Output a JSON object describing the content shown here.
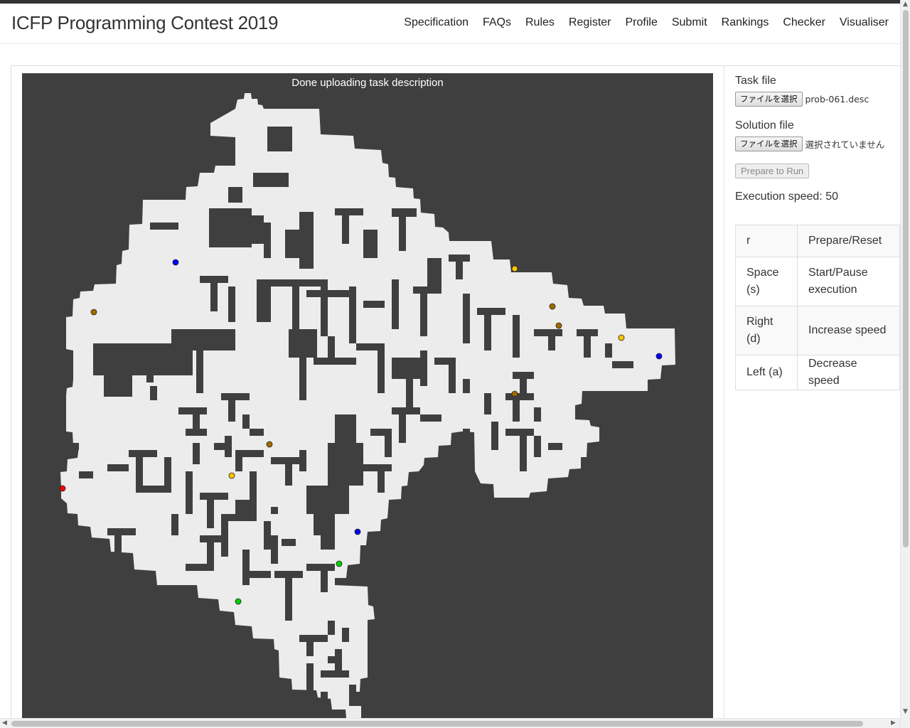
{
  "site_title": "ICFP Programming Contest 2019",
  "nav": [
    "Specification",
    "FAQs",
    "Rules",
    "Register",
    "Profile",
    "Submit",
    "Rankings",
    "Checker",
    "Visualiser"
  ],
  "canvas": {
    "status_text": "Done uploading task description",
    "background_color": "#3f3f3f",
    "map_color": "#ececec",
    "boosters": [
      {
        "type": "start",
        "color": "#ff0000"
      },
      {
        "type": "B",
        "color": "#ffc400"
      },
      {
        "type": "F",
        "color": "#a06a00"
      },
      {
        "type": "L",
        "color": "#00cc00"
      },
      {
        "type": "X",
        "color": "#0000ff"
      }
    ]
  },
  "side": {
    "task_label": "Task file",
    "task_button": "ファイルを選択",
    "task_file_name": "prob-061.desc",
    "solution_label": "Solution file",
    "solution_button": "ファイルを選択",
    "solution_file_name": "選択されていません",
    "prepare_button": "Prepare to Run",
    "speed_text": "Execution speed: 50"
  },
  "keys": [
    {
      "key": "r",
      "action": "Prepare/Reset"
    },
    {
      "key": "Space (s)",
      "action": "Start/Pause execution"
    },
    {
      "key": "Right (d)",
      "action": "Increase speed"
    },
    {
      "key": "Left (a)",
      "action": "Decrease speed"
    }
  ]
}
